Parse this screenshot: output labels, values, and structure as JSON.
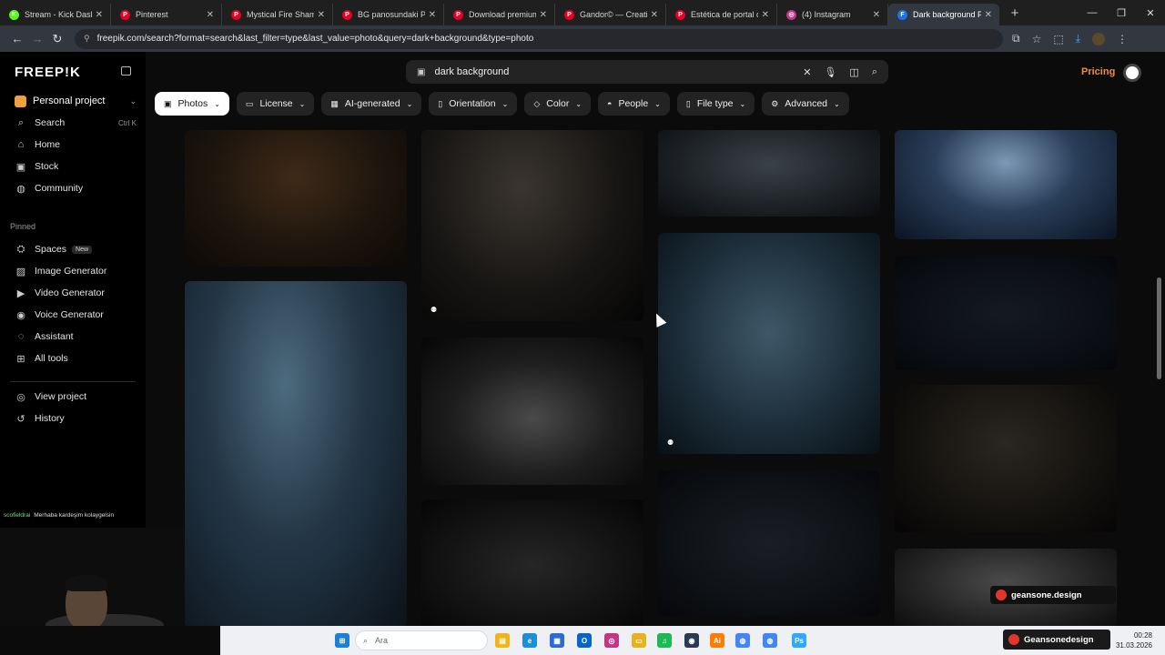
{
  "browser": {
    "tabs": [
      {
        "label": "Stream - Kick Dashbo",
        "color": "#53fc18",
        "glyph": "K",
        "active": false
      },
      {
        "label": "Pinterest",
        "color": "#e60023",
        "glyph": "P",
        "active": false
      },
      {
        "label": "Mystical Fire Shaman",
        "color": "#e60023",
        "glyph": "P",
        "active": false
      },
      {
        "label": "BG panosundaki Pin",
        "color": "#e60023",
        "glyph": "P",
        "active": false
      },
      {
        "label": "Download premium",
        "color": "#e60023",
        "glyph": "P",
        "active": false
      },
      {
        "label": "Gandor© — Creative",
        "color": "#e60023",
        "glyph": "P",
        "active": false
      },
      {
        "label": "Estética de portal dig",
        "color": "#e60023",
        "glyph": "P",
        "active": false
      },
      {
        "label": "(4) Instagram",
        "color": "#c13584",
        "glyph": "◎",
        "active": false
      },
      {
        "label": "Dark background Ph",
        "color": "#1a73e8",
        "glyph": "F",
        "active": true
      }
    ],
    "url": "freepik.com/search?format=search&last_filter=type&last_value=photo&query=dark+background&type=photo"
  },
  "sidebar": {
    "logo": "FREEP!K",
    "project": "Personal project",
    "items": [
      {
        "label": "Search",
        "icon": "search-icon",
        "glyph": "⌕",
        "kbd": "Ctrl K"
      },
      {
        "label": "Home",
        "icon": "home-icon",
        "glyph": "⌂"
      },
      {
        "label": "Stock",
        "icon": "stock-icon",
        "glyph": "▣"
      },
      {
        "label": "Community",
        "icon": "globe-icon",
        "glyph": "◍"
      }
    ],
    "pinned_label": "Pinned",
    "pinned": [
      {
        "label": "Spaces",
        "icon": "spaces-icon",
        "glyph": "⛭",
        "badge": "New"
      },
      {
        "label": "Image Generator",
        "icon": "image-icon",
        "glyph": "▨"
      },
      {
        "label": "Video Generator",
        "icon": "video-icon",
        "glyph": "▶"
      },
      {
        "label": "Voice Generator",
        "icon": "voice-icon",
        "glyph": "◉"
      },
      {
        "label": "Assistant",
        "icon": "assistant-icon",
        "glyph": "◌"
      },
      {
        "label": "All tools",
        "icon": "grid-icon",
        "glyph": "⊞"
      }
    ],
    "bottom": [
      {
        "label": "View project",
        "icon": "project-icon",
        "glyph": "◎"
      },
      {
        "label": "History",
        "icon": "history-icon",
        "glyph": "↺"
      }
    ]
  },
  "chat": {
    "user": "scofieldrai",
    "message": "Merhaba kardeşim kolaygelsin"
  },
  "search": {
    "query": "dark background"
  },
  "header": {
    "pricing": "Pricing"
  },
  "filters": [
    {
      "label": "Photos",
      "glyph": "▣",
      "selected": true
    },
    {
      "label": "License",
      "glyph": "▭",
      "selected": false
    },
    {
      "label": "AI-generated",
      "glyph": "▦",
      "selected": false
    },
    {
      "label": "Orientation",
      "glyph": "▯",
      "selected": false
    },
    {
      "label": "Color",
      "glyph": "◇",
      "selected": false
    },
    {
      "label": "People",
      "glyph": "◓",
      "selected": false
    },
    {
      "label": "File type",
      "glyph": "▯",
      "selected": false
    },
    {
      "label": "Advanced",
      "glyph": "⚙",
      "selected": false
    }
  ],
  "results": [
    {
      "bg": "radial-gradient(ellipse at 50% 35%, #3e2a18 0%, #1e150d 55%, #0c0906 100%)",
      "ai": false
    },
    {
      "bg": "radial-gradient(ellipse at 45% 30%, #3a3530 0%, #181614 55%, #050505 100%)",
      "ai": true
    },
    {
      "bg": "radial-gradient(ellipse at 50% 40%, #3a4148 0%, #1c2024 60%, #0a0b0d 100%)",
      "ai": false
    },
    {
      "bg": "radial-gradient(ellipse at 50% 30%, #7d99b6 0%, #2a3f5a 45%, #0b1322 100%)",
      "ai": false
    },
    {
      "bg": "radial-gradient(ellipse at 45% 30%, #4d6b7f 0%, #243747 45%, #0b121a 100%)",
      "ai": false
    },
    {
      "bg": "radial-gradient(ellipse at 50% 55%, #4a4a4a 0%, #1e1e1e 50%, #060606 100%)",
      "ai": false
    },
    {
      "bg": "radial-gradient(ellipse at 50% 45%, #3e5868 0%, #1d2e3a 55%, #081016 100%)",
      "ai": true
    },
    {
      "bg": "radial-gradient(ellipse at 50% 50%, #151922 0%, #0c0f15 60%, #05070a 100%)",
      "ai": false
    },
    {
      "bg": "radial-gradient(ellipse at 50% 50%, #262626 0%, #121212 60%, #050505 100%)",
      "ai": false
    },
    {
      "bg": "radial-gradient(ellipse at 50% 50%, #1a1e24 0%, #0e1115 60%, #06070a 100%)",
      "ai": false
    },
    {
      "bg": "radial-gradient(ellipse at 50% 40%, #2a2620 0%, #14120f 60%, #060505 100%)",
      "ai": false
    },
    {
      "bg": "radial-gradient(ellipse at 50% 40%, #4a4a4a 0%, #222 60%, #0a0a0a 100%)",
      "ai": false
    }
  ],
  "taskbar": {
    "search_placeholder": "Ara",
    "apps": [
      {
        "name": "file-explorer",
        "glyph": "▤",
        "color": "#f2b418"
      },
      {
        "name": "edge",
        "glyph": "e",
        "color": "#1c8fd6"
      },
      {
        "name": "store",
        "glyph": "▦",
        "color": "#2a6bd8"
      },
      {
        "name": "outlook",
        "glyph": "O",
        "color": "#0a64c8"
      },
      {
        "name": "instagram",
        "glyph": "◎",
        "color": "#c13584"
      },
      {
        "name": "folder",
        "glyph": "▭",
        "color": "#e6b31e"
      },
      {
        "name": "spotify",
        "glyph": "♫",
        "color": "#1db954"
      },
      {
        "name": "steam",
        "glyph": "◉",
        "color": "#2a3a55"
      },
      {
        "name": "illustrator",
        "glyph": "Ai",
        "color": "#ff7c00"
      },
      {
        "name": "chrome",
        "glyph": "◍",
        "color": "#4285f4"
      },
      {
        "name": "chrome-active",
        "glyph": "◍",
        "color": "#4285f4"
      },
      {
        "name": "photoshop",
        "glyph": "Ps",
        "color": "#31a8ff"
      }
    ],
    "time": "00:28",
    "date": "31.03.2026"
  },
  "overlays": {
    "brand1": "geansone.design",
    "brand2": "Geansonedesign"
  }
}
